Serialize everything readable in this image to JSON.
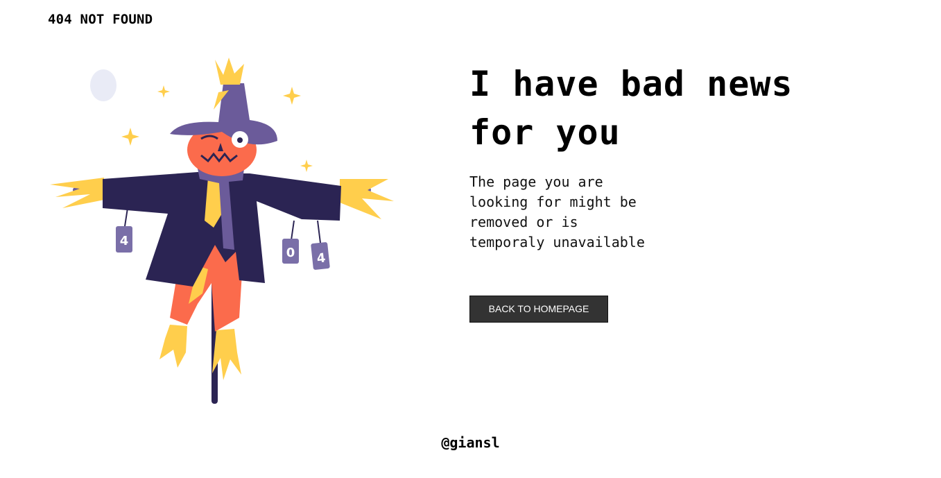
{
  "header": {
    "title": "404 NOT FOUND"
  },
  "illustration": {
    "icon": "scarecrow-illustration",
    "cans": [
      "4",
      "0",
      "4"
    ]
  },
  "main": {
    "headline": "I have bad news for you",
    "message": "The page you are\nlooking for might be\nremoved or is\ntemporaly unavailable",
    "button_label": "BACK TO HOMEPAGE"
  },
  "footer": {
    "credit": "@giansl"
  },
  "colors": {
    "button_bg": "#333333",
    "coat": "#2b2453",
    "hat": "#6b5b9a",
    "face": "#fb6b4c",
    "straw": "#ffce4c",
    "can": "#7a6fa8",
    "moon": "#e9ebf6"
  }
}
